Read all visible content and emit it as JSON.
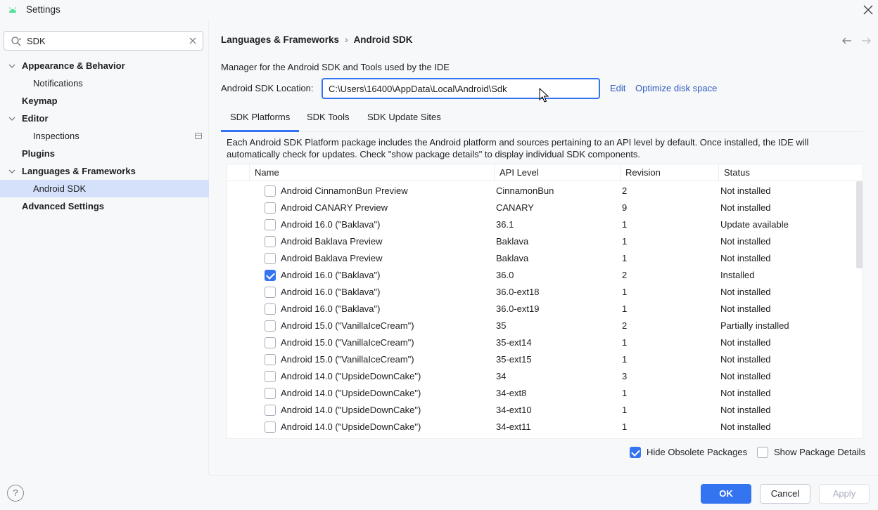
{
  "window": {
    "title": "Settings"
  },
  "search": {
    "value": "SDK"
  },
  "sidebar": {
    "items": [
      {
        "label": "Appearance & Behavior",
        "bold": true,
        "indent": false,
        "expanded": true
      },
      {
        "label": "Notifications",
        "bold": false,
        "indent": true
      },
      {
        "label": "Keymap",
        "bold": true,
        "indent": false
      },
      {
        "label": "Editor",
        "bold": true,
        "indent": false,
        "expanded": true
      },
      {
        "label": "Inspections",
        "bold": false,
        "indent": true,
        "badge": true
      },
      {
        "label": "Plugins",
        "bold": true,
        "indent": false
      },
      {
        "label": "Languages & Frameworks",
        "bold": true,
        "indent": false,
        "expanded": true
      },
      {
        "label": "Android SDK",
        "bold": false,
        "indent": true,
        "selected": true
      },
      {
        "label": "Advanced Settings",
        "bold": true,
        "indent": false
      }
    ]
  },
  "breadcrumb": {
    "parent": "Languages & Frameworks",
    "sep": "›",
    "current": "Android SDK"
  },
  "description": "Manager for the Android SDK and Tools used by the IDE",
  "location": {
    "label": "Android SDK Location:",
    "value": "C:\\Users\\16400\\AppData\\Local\\Android\\Sdk",
    "edit_link": "Edit",
    "optimize_link": "Optimize disk space"
  },
  "tabs": [
    {
      "label": "SDK Platforms",
      "active": true
    },
    {
      "label": "SDK Tools",
      "active": false
    },
    {
      "label": "SDK Update Sites",
      "active": false
    }
  ],
  "info_text": "Each Android SDK Platform package includes the Android platform and sources pertaining to an API level by default. Once installed, the IDE will automatically check for updates. Check \"show package details\" to display individual SDK components.",
  "table": {
    "columns": [
      "Name",
      "API Level",
      "Revision",
      "Status"
    ],
    "rows": [
      {
        "checked": false,
        "name": "Android CinnamonBun Preview",
        "api": "CinnamonBun",
        "revision": "2",
        "status": "Not installed"
      },
      {
        "checked": false,
        "name": "Android CANARY Preview",
        "api": "CANARY",
        "revision": "9",
        "status": "Not installed"
      },
      {
        "checked": false,
        "name": "Android 16.0 (\"Baklava\")",
        "api": "36.1",
        "revision": "1",
        "status": "Update available"
      },
      {
        "checked": false,
        "name": "Android Baklava Preview",
        "api": "Baklava",
        "revision": "1",
        "status": "Not installed"
      },
      {
        "checked": false,
        "name": "Android Baklava Preview",
        "api": "Baklava",
        "revision": "1",
        "status": "Not installed"
      },
      {
        "checked": true,
        "name": "Android 16.0 (\"Baklava\")",
        "api": "36.0",
        "revision": "2",
        "status": "Installed"
      },
      {
        "checked": false,
        "name": "Android 16.0 (\"Baklava\")",
        "api": "36.0-ext18",
        "revision": "1",
        "status": "Not installed"
      },
      {
        "checked": false,
        "name": "Android 16.0 (\"Baklava\")",
        "api": "36.0-ext19",
        "revision": "1",
        "status": "Not installed"
      },
      {
        "checked": false,
        "name": "Android 15.0 (\"VanillaIceCream\")",
        "api": "35",
        "revision": "2",
        "status": "Partially installed"
      },
      {
        "checked": false,
        "name": "Android 15.0 (\"VanillaIceCream\")",
        "api": "35-ext14",
        "revision": "1",
        "status": "Not installed"
      },
      {
        "checked": false,
        "name": "Android 15.0 (\"VanillaIceCream\")",
        "api": "35-ext15",
        "revision": "1",
        "status": "Not installed"
      },
      {
        "checked": false,
        "name": "Android 14.0 (\"UpsideDownCake\")",
        "api": "34",
        "revision": "3",
        "status": "Not installed"
      },
      {
        "checked": false,
        "name": "Android 14.0 (\"UpsideDownCake\")",
        "api": "34-ext8",
        "revision": "1",
        "status": "Not installed"
      },
      {
        "checked": false,
        "name": "Android 14.0 (\"UpsideDownCake\")",
        "api": "34-ext10",
        "revision": "1",
        "status": "Not installed"
      },
      {
        "checked": false,
        "name": "Android 14.0 (\"UpsideDownCake\")",
        "api": "34-ext11",
        "revision": "1",
        "status": "Not installed"
      }
    ]
  },
  "options": {
    "hide_obsolete": {
      "label": "Hide Obsolete Packages",
      "checked": true
    },
    "show_details": {
      "label": "Show Package Details",
      "checked": false
    }
  },
  "buttons": {
    "ok": "OK",
    "cancel": "Cancel",
    "apply": "Apply",
    "help": "?"
  },
  "colors": {
    "accent": "#3574f0",
    "selection": "#d5e1fb",
    "link": "#2e5bbe",
    "android_green": "#3ddc84"
  },
  "icons": {
    "app": "android-icon",
    "close": "close-icon",
    "search": "search-icon",
    "clear": "clear-icon",
    "back": "arrow-left-icon",
    "forward": "arrow-right-icon",
    "help": "help-icon"
  }
}
